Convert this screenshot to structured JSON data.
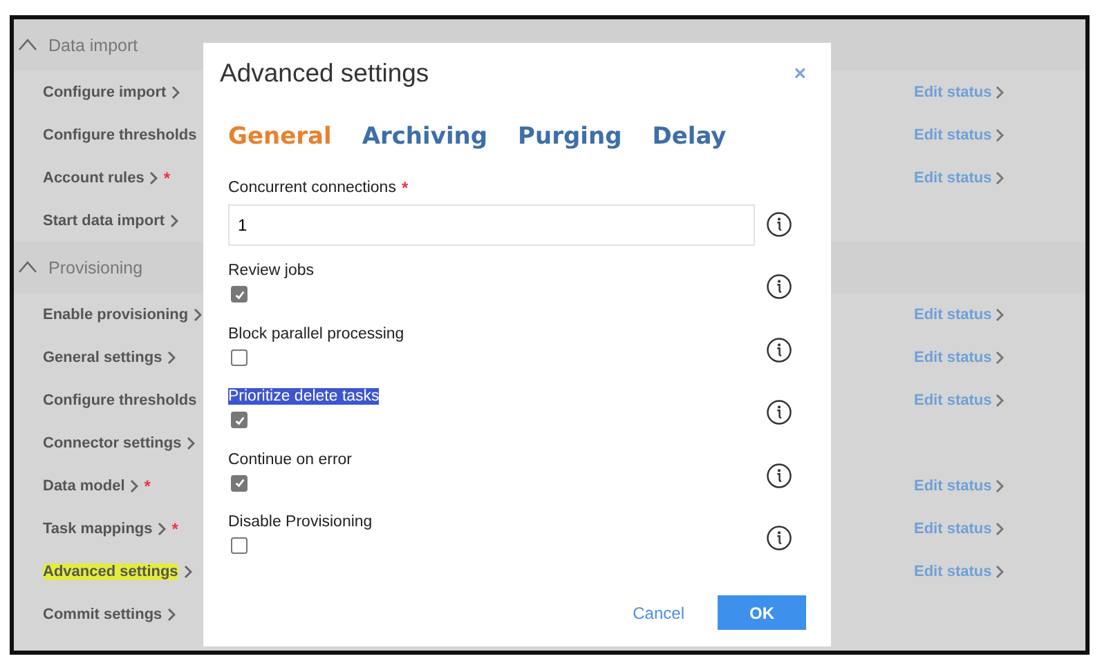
{
  "sections": [
    {
      "title": "Data import",
      "expanded": true,
      "items": [
        {
          "label": "Configure import",
          "chevron": true,
          "highlighted": false,
          "action": "Edit status"
        },
        {
          "label": "Configure thresholds",
          "chevron": false,
          "highlighted": false,
          "action": "Edit status"
        },
        {
          "label": "Account rules",
          "chevron": true,
          "required_mark": "*",
          "highlighted": false,
          "action": "Edit status"
        },
        {
          "label": "Start data import",
          "chevron": true,
          "highlighted": false
        }
      ]
    },
    {
      "title": "Provisioning",
      "expanded": true,
      "items": [
        {
          "label": "Enable provisioning",
          "chevron": true,
          "highlighted": false,
          "action": "Edit status"
        },
        {
          "label": "General settings",
          "chevron": true,
          "highlighted": false,
          "action": "Edit status"
        },
        {
          "label": "Configure thresholds",
          "chevron": false,
          "highlighted": false,
          "action": "Edit status"
        },
        {
          "label": "Connector settings",
          "chevron": true,
          "highlighted": false
        },
        {
          "label": "Data model",
          "chevron": true,
          "required_mark": "*",
          "highlighted": false,
          "action": "Edit status"
        },
        {
          "label": "Task mappings",
          "chevron": true,
          "required_mark": "*",
          "highlighted": false,
          "action": "Edit status"
        },
        {
          "label": "Advanced settings",
          "chevron": true,
          "highlighted": true,
          "action": "Edit status"
        },
        {
          "label": "Commit settings",
          "chevron": true,
          "highlighted": false
        }
      ]
    }
  ],
  "dialog": {
    "title": "Advanced settings",
    "close": "×",
    "tabs": [
      {
        "label": "General",
        "selected": true
      },
      {
        "label": "Archiving",
        "selected": false
      },
      {
        "label": "Purging",
        "selected": false
      },
      {
        "label": "Delay",
        "selected": false
      }
    ],
    "fields": [
      {
        "kind": "text",
        "label": "Concurrent connections",
        "required_mark": "*",
        "value": "1",
        "text_selected": false
      },
      {
        "kind": "checkbox",
        "label": "Review jobs",
        "checked": true,
        "text_selected": false
      },
      {
        "kind": "checkbox",
        "label": "Block parallel processing",
        "checked": false,
        "text_selected": false
      },
      {
        "kind": "checkbox",
        "label": "Prioritize delete tasks",
        "checked": true,
        "text_selected": true
      },
      {
        "kind": "checkbox",
        "label": "Continue on error",
        "checked": true,
        "text_selected": false
      },
      {
        "kind": "checkbox",
        "label": "Disable Provisioning",
        "checked": false,
        "text_selected": false
      }
    ],
    "buttons": {
      "cancel": "Cancel",
      "ok": "OK"
    }
  }
}
